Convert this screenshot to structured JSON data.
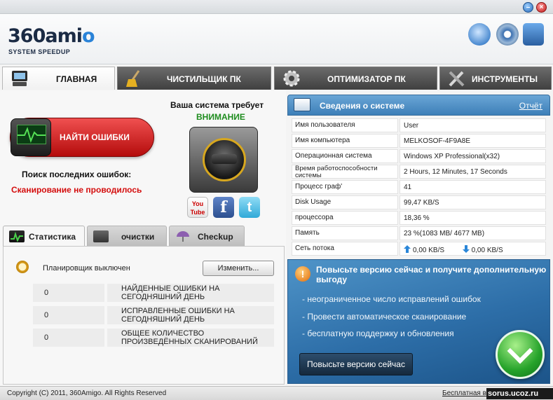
{
  "window": {
    "minimize_symbol": "–",
    "close_symbol": "×"
  },
  "logo": {
    "main_prefix": "360ami",
    "main_accent": "o",
    "sub": "SYSTEM SPEEDUP"
  },
  "header_icons": [
    "update-icon",
    "settings-gear-icon",
    "support-icon"
  ],
  "tabs": [
    {
      "label": "ГЛАВНАЯ",
      "icon": "home-computer-icon",
      "active": true
    },
    {
      "label": "ЧИСТИЛЬЩИК ПК",
      "icon": "broom-icon",
      "active": false
    },
    {
      "label": "ОПТИМИЗАТОР ПК",
      "icon": "gear-icon",
      "active": false
    },
    {
      "label": "ИНСТРУМЕНТЫ",
      "icon": "tools-icon",
      "active": false
    }
  ],
  "main": {
    "scan_button": "НАЙТИ ОШИБКИ",
    "search_last_errors": "Поиск последних ошибок:",
    "scan_status": "Сканирование не проводилось",
    "system_needs": "Ваша система требует",
    "attention": "ВНИМАНИЕ",
    "social": {
      "youtube": "You Tube",
      "facebook": "f",
      "twitter": "t"
    }
  },
  "subtabs": [
    {
      "label": "Статистика",
      "icon": "statistics-icon",
      "active": true
    },
    {
      "label": "очистки",
      "icon": "cleanup-icon",
      "active": false
    },
    {
      "label": "Checkup",
      "icon": "umbrella-icon",
      "active": false
    }
  ],
  "stats": {
    "scheduler": "Планировщик выключен",
    "change_button": "Изменить...",
    "rows": [
      {
        "value": "0",
        "label": "НАЙДЕННЫЕ ОШИБКИ НА СЕГОДНЯШНИЙ ДЕНЬ"
      },
      {
        "value": "0",
        "label": "ИСПРАВЛЕННЫЕ ОШИБКИ НА СЕГОДНЯШНИЙ ДЕНЬ"
      },
      {
        "value": "0",
        "label": "ОБЩЕЕ КОЛИЧЕСТВО ПРОИЗВЕДЁННЫХ СКАНИРОВАНИЙ"
      }
    ]
  },
  "system_info": {
    "title": "Сведения о системе",
    "report_link": "Отчёт",
    "rows": [
      {
        "label": "Имя пользователя",
        "value": "User"
      },
      {
        "label": "Имя компьютера",
        "value": "MELKOSOF-4F9A8E"
      },
      {
        "label": "Операционная система",
        "value": "Windows XP Professional(x32)"
      },
      {
        "label": "Время работоспособности системы",
        "value": "2 Hours, 12 Minutes, 17 Seconds"
      },
      {
        "label": "Процесс граф'",
        "value": "41"
      },
      {
        "label": "Disk Usage",
        "value": "99,47 KB/S"
      },
      {
        "label": "процессора",
        "value": "18,36 %"
      },
      {
        "label": "Память",
        "value": "23 %(1083 MB/ 4677 MB)"
      }
    ],
    "network": {
      "label": "Сеть потока",
      "up": "0,00 KB/S",
      "down": "0,00 KB/S"
    }
  },
  "promo": {
    "warning_symbol": "!",
    "title": "Повысьте версию сейчас и получите дополнительную выгоду",
    "items": [
      "- неограниченное число исправлений ошибок",
      "- Провести автоматическое сканирование",
      "- бесплатную поддержку и обновления"
    ],
    "upgrade_button": "Повысьте версию сейчас"
  },
  "footer": {
    "copyright": "Copyright (C) 2011, 360Amigo. All Rights Reserved",
    "free_link": "Бесплатная в",
    "watermark": "sorus.ucoz.ru"
  },
  "colors": {
    "accent_blue": "#3d7fb8",
    "scan_red": "#d40d0d",
    "attention_green": "#1e8c1e",
    "tab_dark": "#404040"
  }
}
